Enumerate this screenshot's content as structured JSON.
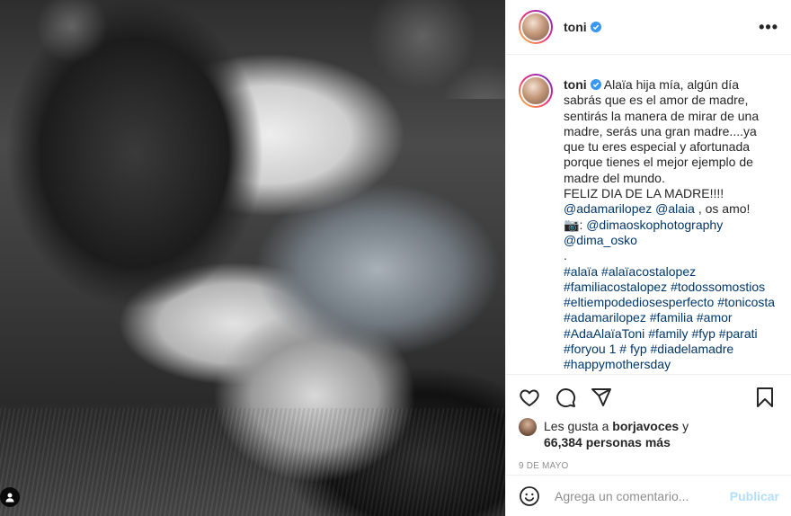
{
  "post": {
    "username": "toni",
    "more_label": "•••"
  },
  "caption": {
    "username": "toni",
    "lines": [
      "Alaïa hija mía, algún día sabrás que es el amor de madre, sentirás la manera de mirar de una madre, serás una gran madre....ya que tu eres especial y afortunada porque tienes el mejor ejemplo de madre del mundo.",
      "FELIZ DIA DE LA MADRE!!!!"
    ],
    "mention_line": {
      "m1": "@adamarilopez",
      "m2": "@alaia",
      "tail": " , os amo!"
    },
    "camera_emoji": "📷",
    "photo_credit": {
      "sep": ": ",
      "m1": "@dimaoskophotography",
      "m2": "@dima_osko"
    },
    "dot": ".",
    "hashtags": [
      "#alaïa",
      "#alaïacostalopez",
      "#familiacostalopez",
      "#todossomostios",
      "#eltiempodediosesperfecto",
      "#tonicosta",
      "#adamarilopez",
      "#familia",
      "#amor",
      "#AdaAlaïaToni",
      "#family",
      "#fyp",
      "#parati",
      "#foryou",
      "1 # fyp",
      "#diadelamadre",
      "#happymothersday"
    ]
  },
  "likes": {
    "prefix": "Les gusta a ",
    "user": "borjavoces",
    "mid": " y",
    "count": "66,384 personas más"
  },
  "date": "9 DE MAYO",
  "comment": {
    "placeholder": "Agrega un comentario...",
    "post_label": "Publicar"
  },
  "colors": {
    "link": "#00376b",
    "verified": "#3897f0",
    "post_disabled": "#b2dffc",
    "muted": "#8e8e8e"
  },
  "icons": [
    "heart-icon",
    "comment-icon",
    "share-icon",
    "bookmark-icon",
    "emoji-icon",
    "verified-icon",
    "more-icon",
    "user-tag-icon"
  ]
}
